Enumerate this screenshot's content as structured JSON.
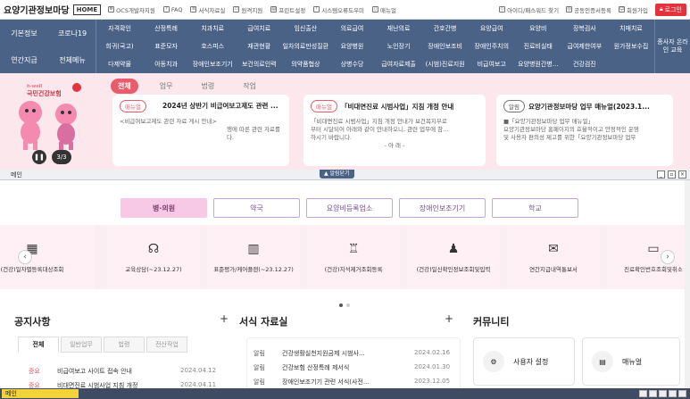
{
  "topbar": {
    "brand": "요양기관정보마당",
    "home": "HOME",
    "links": [
      "OCS개발자지원",
      "FAQ",
      "서식자료실",
      "원격지원",
      "프린트설정",
      "시스템오류도우미",
      "매뉴얼"
    ],
    "right_links": [
      "아이디/패스워드 찾기",
      "공동인증서등록",
      "회원가입"
    ],
    "login": "로그인"
  },
  "nav": {
    "left": [
      "기본정보",
      "코로나19",
      "연간지급",
      "전체메뉴"
    ],
    "rows": [
      [
        "자격확인",
        "산정특례",
        "치과치료",
        "급여치료",
        "임신출산",
        "의료급여",
        "재난의료",
        "간호간병",
        "요양급여",
        "요양비",
        "장복검사",
        "치매치료"
      ],
      [
        "희귀(국고)",
        "표준모자",
        "호스피스",
        "재관현황",
        "일차의료만성질환",
        "요양병원",
        "노인장기",
        "장애인보조비",
        "장애인주치의",
        "진료비실태",
        "급여제한여부",
        "원가정보수집"
      ],
      [
        "다제약물",
        "아동치과",
        "장애인보조기기",
        "보건의료인력",
        "의약품협상",
        "상병수당",
        "급여자료제출",
        "(시범)진료지원",
        "비급여보고",
        "요양병원간병...",
        "건강검진",
        ""
      ]
    ],
    "right": "종사자 온라인 교육"
  },
  "banner": {
    "logo_small": "h-well",
    "logo": "국민건강보험",
    "counter": "3/3",
    "tabs": [
      "전체",
      "업무",
      "법령",
      "작업"
    ],
    "cards": [
      {
        "badge": "매뉴얼",
        "title": "2024년 상반기 비급여보고제도 관련 ...",
        "body": [
          "<비급여보고제도 관련 자료 게시 안내>",
          "",
          "행에 따른 관련 자료를",
          "다."
        ]
      },
      {
        "badge": "매뉴얼",
        "title": "「비대면진료 시범사업」지침 개정 안내",
        "body": [
          "「비대면진료 시범사업」지침 개정 안내가 보건복지부로",
          "부터 시달되어 아래와 같이 안내하오니, 관련 업무에 참...",
          "하시기 바랍니다.",
          "- 아 래 -"
        ]
      },
      {
        "badge": "알림",
        "title": "요양기관정보마당 업무 매뉴얼(2023.1...",
        "body": [
          "■「요양기관정보마당 업무 매뉴얼」",
          "",
          "요양기관정보마당 홈페이지의 효율적이고 안정적인 운영",
          "및 사용자 편의성 제고를 위한「요양기관정보마당 업무"
        ]
      }
    ]
  },
  "mainbar": {
    "label": "메인",
    "alarm": "▲ 알림닫기"
  },
  "categories": [
    "병·의원",
    "약국",
    "요양비등록업소",
    "장애인보조기기",
    "학교"
  ],
  "services": [
    {
      "label": "(건강)일자별등록대상조회",
      "icon": "calendar-icon"
    },
    {
      "label": "교육상담(~23.12.27)",
      "icon": "headset-icon"
    },
    {
      "label": "표준평가/케어플랜(~23.12.27)",
      "icon": "chart-icon"
    },
    {
      "label": "(건강)치석제거조회등록",
      "icon": "tooth-icon"
    },
    {
      "label": "(건강)일신확인정보조회및입력",
      "icon": "person-icon"
    },
    {
      "label": "연간지급내역통보서",
      "icon": "mail-icon"
    },
    {
      "label": "진료확인번호조회및취소",
      "icon": "monitor-icon"
    }
  ],
  "notice": {
    "title": "공지사항",
    "tabs": [
      "전체",
      "일반업무",
      "법령",
      "전산작업"
    ],
    "rows": [
      {
        "badge": "중요",
        "title": "비급여보고 사이트 접속 안내",
        "date": "2024.04.12"
      },
      {
        "badge": "중요",
        "title": "비대면진료 시범사업 지침 개정",
        "date": "2024.04.11"
      }
    ]
  },
  "forms": {
    "title": "서식 자료실",
    "rows": [
      {
        "badge": "알림",
        "title": "건강생활실천지원금제 시범사...",
        "date": "2024.02.16"
      },
      {
        "badge": "알림",
        "title": "건강보험 산정특례 제서식",
        "date": "2024.01.30"
      },
      {
        "badge": "알림",
        "title": "장애인보조기기 관련 서식(사전...",
        "date": "2023.12.05"
      }
    ]
  },
  "community": {
    "title": "커뮤니티",
    "items": [
      "사용자 설정",
      "매뉴얼"
    ]
  },
  "taskbar": {
    "item": "메인"
  }
}
